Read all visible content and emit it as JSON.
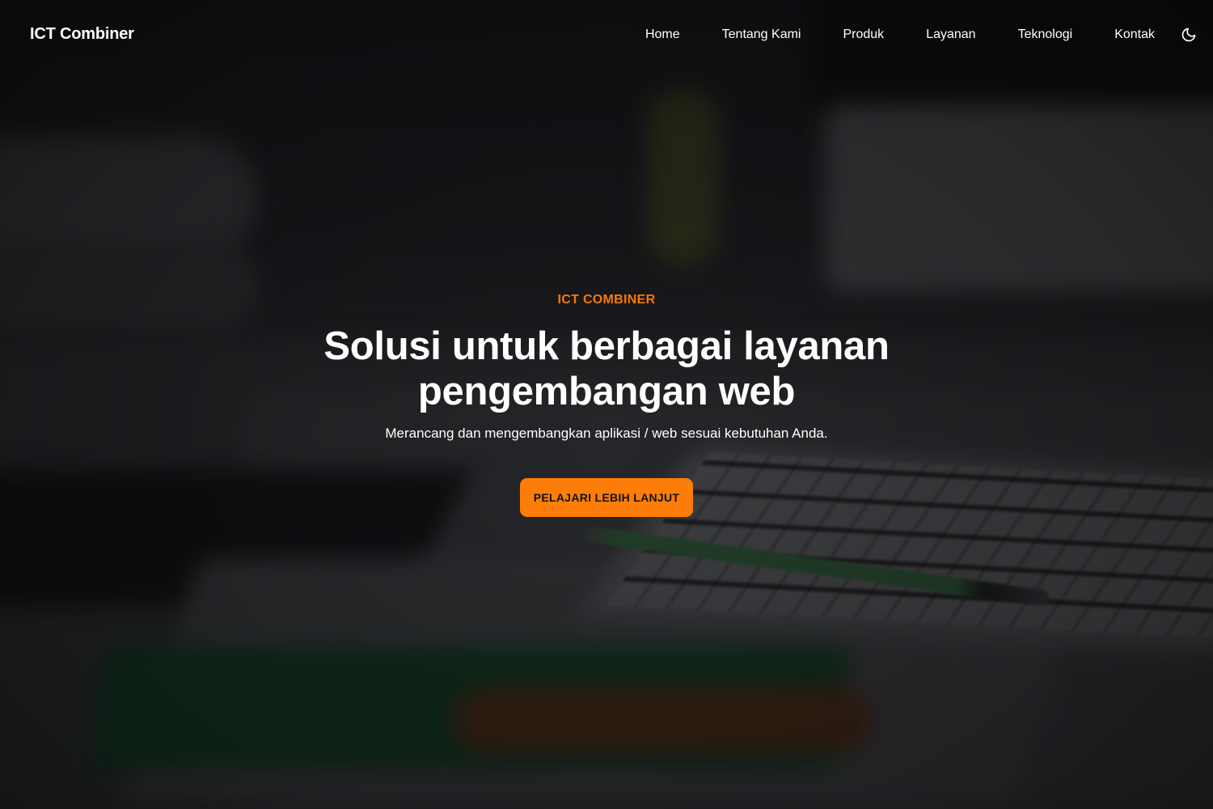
{
  "navbar": {
    "brand": "ICT Combiner",
    "items": [
      {
        "label": "Home"
      },
      {
        "label": "Tentang Kami"
      },
      {
        "label": "Produk"
      },
      {
        "label": "Layanan"
      },
      {
        "label": "Teknologi"
      },
      {
        "label": "Kontak"
      }
    ],
    "theme_toggle_icon": "moon-icon"
  },
  "hero": {
    "eyebrow": "ICT COMBINER",
    "title": "Solusi untuk berbagai layanan pengembangan web",
    "subtitle": "Merancang dan mengembangkan aplikasi / web sesuai kebutuhan Anda.",
    "cta_label": "PELAJARI LEBIH LANJUT",
    "background_icon": "workspace-desk-photo"
  },
  "colors": {
    "accent": "#fd7d08",
    "eyebrow": "#f7790a",
    "text": "#ffffff",
    "background": "#1d1e21"
  }
}
